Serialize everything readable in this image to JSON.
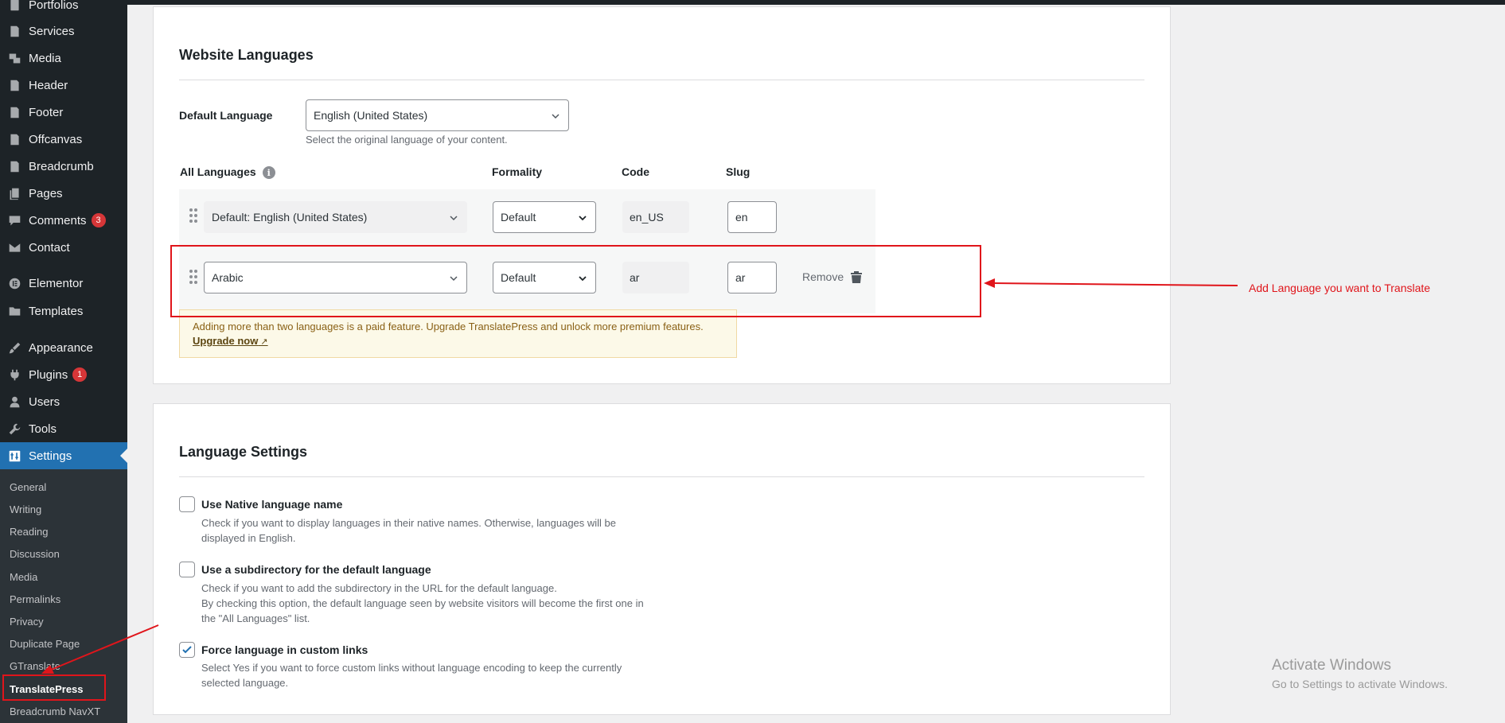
{
  "sidebar": {
    "items": [
      {
        "label": "Portfolios",
        "icon": "portfolio-icon"
      },
      {
        "label": "Services",
        "icon": "services-icon"
      },
      {
        "label": "Media",
        "icon": "media-icon"
      },
      {
        "label": "Header",
        "icon": "header-icon"
      },
      {
        "label": "Footer",
        "icon": "footer-icon"
      },
      {
        "label": "Offcanvas",
        "icon": "offcanvas-icon"
      },
      {
        "label": "Breadcrumb",
        "icon": "breadcrumb-icon"
      },
      {
        "label": "Pages",
        "icon": "pages-icon"
      },
      {
        "label": "Comments",
        "icon": "comments-icon",
        "badge": "3"
      },
      {
        "label": "Contact",
        "icon": "mail-icon"
      },
      {
        "label": "Elementor",
        "icon": "elementor-icon"
      },
      {
        "label": "Templates",
        "icon": "folder-icon"
      },
      {
        "label": "Appearance",
        "icon": "brush-icon"
      },
      {
        "label": "Plugins",
        "icon": "plug-icon",
        "badge": "1"
      },
      {
        "label": "Users",
        "icon": "user-icon"
      },
      {
        "label": "Tools",
        "icon": "wrench-icon"
      },
      {
        "label": "Settings",
        "icon": "settings-icon"
      }
    ],
    "submenu": [
      "General",
      "Writing",
      "Reading",
      "Discussion",
      "Media",
      "Permalinks",
      "Privacy",
      "Duplicate Page",
      "GTranslate",
      "TranslatePress",
      "Breadcrumb NavXT"
    ],
    "current_submenu": "TranslatePress"
  },
  "website_languages": {
    "title": "Website Languages",
    "default_language_label": "Default Language",
    "default_language_value": "English (United States)",
    "default_language_help": "Select the original language of your content.",
    "columns": {
      "all_languages": "All Languages",
      "formality": "Formality",
      "code": "Code",
      "slug": "Slug"
    },
    "rows": [
      {
        "language": "Default: English (United States)",
        "formality": "Default",
        "code": "en_US",
        "slug": "en"
      },
      {
        "language": "Arabic",
        "formality": "Default",
        "code": "ar",
        "slug": "ar",
        "remove_label": "Remove"
      }
    ],
    "notice": {
      "text": "Adding more than two languages is a paid feature. Upgrade TranslatePress and unlock more premium features.",
      "link": "Upgrade now"
    }
  },
  "annotation": "Add Language you want to Translate",
  "language_settings": {
    "title": "Language Settings",
    "options": [
      {
        "title": "Use Native language name",
        "checked": false,
        "desc": [
          "Check if you want to display languages in their native names. Otherwise, languages will be",
          "displayed in English."
        ]
      },
      {
        "title": "Use a subdirectory for the default language",
        "checked": false,
        "desc": [
          "Check if you want to add the subdirectory in the URL for the default language.",
          "By checking this option, the default language seen by website visitors will become the first one in",
          "the \"All Languages\" list."
        ]
      },
      {
        "title": "Force language in custom links",
        "checked": true,
        "desc": [
          "Select Yes if you want to force custom links without language encoding to keep the currently",
          "selected language."
        ]
      }
    ]
  },
  "watermark": {
    "line1": "Activate Windows",
    "line2": "Go to Settings to activate Windows."
  },
  "colors": {
    "accent": "#2271b1",
    "annotation_red": "#e0151b",
    "badge_red": "#d63638"
  }
}
